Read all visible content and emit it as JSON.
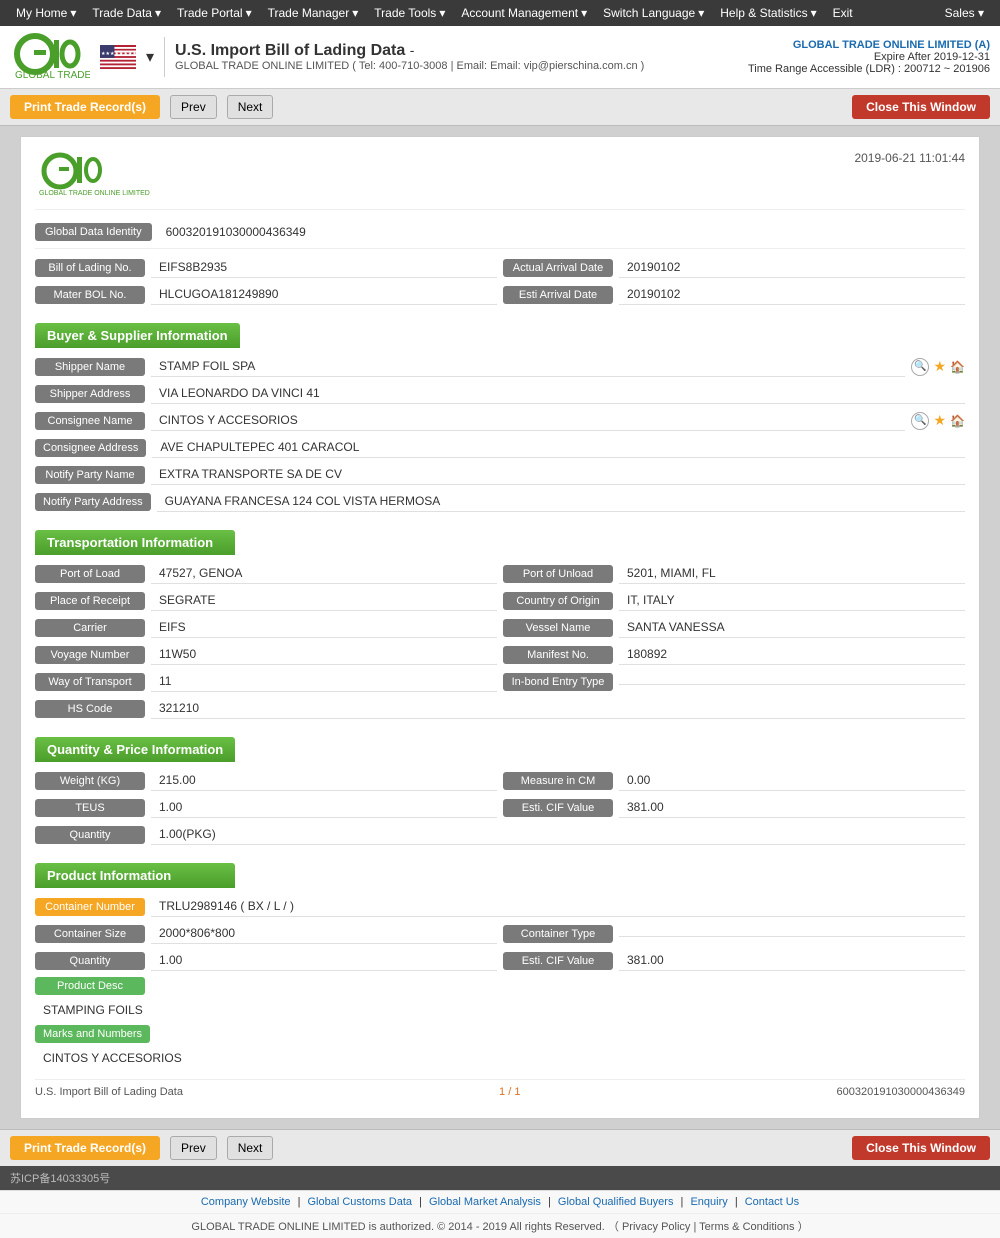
{
  "nav": {
    "items": [
      "My Home",
      "Trade Data",
      "Trade Portal",
      "Trade Manager",
      "Trade Tools",
      "Account Management",
      "Switch Language",
      "Help & Statistics",
      "Exit"
    ],
    "sales": "Sales"
  },
  "header": {
    "title": "U.S. Import Bill of Lading Data",
    "subtitle_company": "GLOBAL TRADE ONLINE LIMITED",
    "subtitle_tel": "Tel: 400-710-3008",
    "subtitle_email": "Email: vip@pierschina.com.cn",
    "account_company": "GLOBAL TRADE ONLINE LIMITED (A)",
    "expire": "Expire After 2019-12-31",
    "ldr": "Time Range Accessible (LDR) : 200712 ~ 201906"
  },
  "toolbar": {
    "print_label": "Print Trade Record(s)",
    "prev_label": "Prev",
    "next_label": "Next",
    "close_label": "Close This Window"
  },
  "record": {
    "timestamp": "2019-06-21 11:01:44",
    "global_data_identity_label": "Global Data Identity",
    "global_data_identity_value": "600320191030000436349",
    "bill_of_lading_no_label": "Bill of Lading No.",
    "bill_of_lading_no_value": "EIFS8B2935",
    "actual_arrival_date_label": "Actual Arrival Date",
    "actual_arrival_date_value": "20190102",
    "mater_bol_no_label": "Mater BOL No.",
    "mater_bol_no_value": "HLCUGOA181249890",
    "esti_arrival_date_label": "Esti Arrival Date",
    "esti_arrival_date_value": "20190102"
  },
  "buyer_supplier": {
    "section_title": "Buyer & Supplier Information",
    "shipper_name_label": "Shipper Name",
    "shipper_name_value": "STAMP FOIL SPA",
    "shipper_address_label": "Shipper Address",
    "shipper_address_value": "VIA LEONARDO DA VINCI 41",
    "consignee_name_label": "Consignee Name",
    "consignee_name_value": "CINTOS Y ACCESORIOS",
    "consignee_address_label": "Consignee Address",
    "consignee_address_value": "AVE CHAPULTEPEC 401 CARACOL",
    "notify_party_name_label": "Notify Party Name",
    "notify_party_name_value": "EXTRA TRANSPORTE SA DE CV",
    "notify_party_address_label": "Notify Party Address",
    "notify_party_address_value": "GUAYANA FRANCESA 124 COL VISTA HERMOSA"
  },
  "transportation": {
    "section_title": "Transportation Information",
    "port_of_load_label": "Port of Load",
    "port_of_load_value": "47527, GENOA",
    "port_of_unload_label": "Port of Unload",
    "port_of_unload_value": "5201, MIAMI, FL",
    "place_of_receipt_label": "Place of Receipt",
    "place_of_receipt_value": "SEGRATE",
    "country_of_origin_label": "Country of Origin",
    "country_of_origin_value": "IT, ITALY",
    "carrier_label": "Carrier",
    "carrier_value": "EIFS",
    "vessel_name_label": "Vessel Name",
    "vessel_name_value": "SANTA VANESSA",
    "voyage_number_label": "Voyage Number",
    "voyage_number_value": "11W50",
    "manifest_no_label": "Manifest No.",
    "manifest_no_value": "180892",
    "way_of_transport_label": "Way of Transport",
    "way_of_transport_value": "11",
    "in_bond_entry_type_label": "In-bond Entry Type",
    "in_bond_entry_type_value": "",
    "hs_code_label": "HS Code",
    "hs_code_value": "321210"
  },
  "quantity_price": {
    "section_title": "Quantity & Price Information",
    "weight_label": "Weight (KG)",
    "weight_value": "215.00",
    "measure_in_cm_label": "Measure in CM",
    "measure_in_cm_value": "0.00",
    "teus_label": "TEUS",
    "teus_value": "1.00",
    "esti_cif_value_label": "Esti. CIF Value",
    "esti_cif_value_value": "381.00",
    "quantity_label": "Quantity",
    "quantity_value": "1.00(PKG)"
  },
  "product": {
    "section_title": "Product Information",
    "container_number_label": "Container Number",
    "container_number_value": "TRLU2989146 ( BX / L / )",
    "container_size_label": "Container Size",
    "container_size_value": "2000*806*800",
    "container_type_label": "Container Type",
    "container_type_value": "",
    "quantity_label": "Quantity",
    "quantity_value": "1.00",
    "esti_cif_label": "Esti. CIF Value",
    "esti_cif_value": "381.00",
    "product_desc_label": "Product Desc",
    "product_desc_value": "STAMPING FOILS",
    "marks_and_numbers_label": "Marks and Numbers",
    "marks_and_numbers_value": "CINTOS Y ACCESORIOS"
  },
  "pagination": {
    "record_type": "U.S. Import Bill of Lading Data",
    "page": "1 / 1",
    "record_id": "600320191030000436349"
  },
  "footer": {
    "icp": "苏ICP备14033305号",
    "links": [
      "Company Website",
      "Global Customs Data",
      "Global Market Analysis",
      "Global Qualified Buyers",
      "Enquiry",
      "Contact Us"
    ],
    "copyright": "GLOBAL TRADE ONLINE LIMITED is authorized. © 2014 - 2019 All rights Reserved.  （ Privacy Policy  |  Terms & Conditions  ）"
  }
}
